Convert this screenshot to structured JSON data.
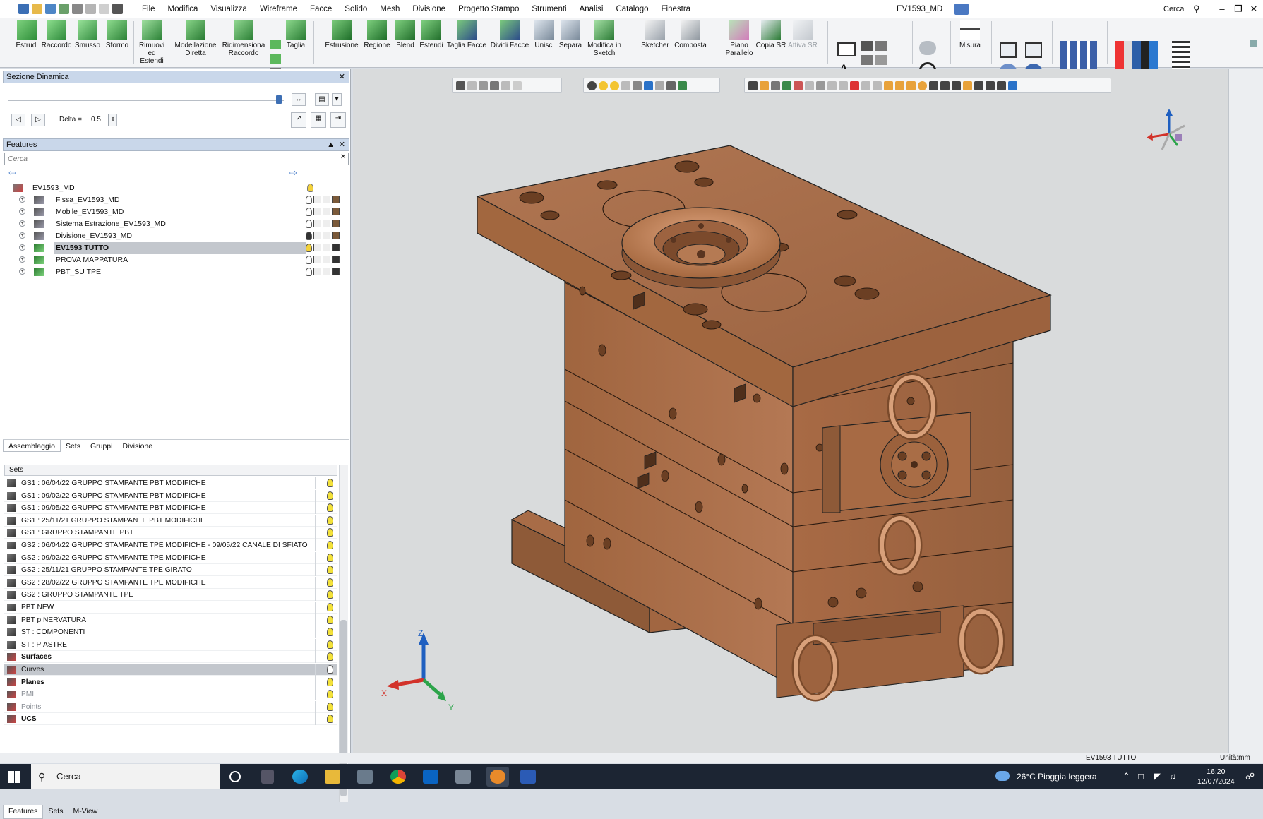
{
  "menu": [
    "File",
    "Modifica",
    "Visualizza",
    "Wireframe",
    "Facce",
    "Solido",
    "Mesh",
    "Divisione",
    "Progetto Stampo",
    "Strumenti",
    "Analisi",
    "Catalogo",
    "Finestra"
  ],
  "doc_title": "EV1593_MD",
  "search": {
    "label": "Cerca"
  },
  "ribbon": {
    "estrudi": "Estrudi",
    "raccordo": "Raccordo",
    "smusso": "Smusso",
    "sformo": "Sformo",
    "rimuovi_1": "Rimuovi ed",
    "rimuovi_2": "Estendi",
    "modellazione_1": "Modellazione",
    "modellazione_2": "Diretta",
    "ridim_1": "Ridimensiona",
    "ridim_2": "Raccordo",
    "taglia": "Taglia",
    "estrusione": "Estrusione",
    "regione": "Regione",
    "blend": "Blend",
    "estendi": "Estendi",
    "taglia_facce": "Taglia Facce",
    "dividi_facce": "Dividi Facce",
    "unisci": "Unisci",
    "separa": "Separa",
    "modifica_sketch_1": "Modifica in",
    "modifica_sketch_2": "Sketch",
    "sketcher": "Sketcher",
    "composta": "Composta",
    "piano_1": "Piano",
    "piano_2": "Parallelo",
    "copia_sr": "Copia SR",
    "attiva_sr": "Attiva SR",
    "misura": "Misura"
  },
  "sezione": {
    "title": "Sezione Dinamica",
    "delta_label": "Delta =",
    "delta_value": "0.5"
  },
  "features": {
    "title": "Features",
    "search_placeholder": "Cerca",
    "root": "EV1593_MD",
    "items": [
      {
        "label": "Fissa_EV1593_MD"
      },
      {
        "label": "Mobile_EV1593_MD"
      },
      {
        "label": "Sistema Estrazione_EV1593_MD"
      },
      {
        "label": "Divisione_EV1593_MD"
      },
      {
        "label": "EV1593 TUTTO"
      },
      {
        "label": "PROVA MAPPATURA"
      },
      {
        "label": "PBT_SU TPE"
      }
    ]
  },
  "tabs_top": [
    "Assemblaggio",
    "Sets",
    "Gruppi",
    "Divisione"
  ],
  "sets": {
    "header": "Sets",
    "rows": [
      "GS1 : 06/04/22 GRUPPO STAMPANTE PBT MODIFICHE",
      "GS1 : 09/02/22 GRUPPO STAMPANTE PBT MODIFICHE",
      "GS1 : 09/05/22 GRUPPO STAMPANTE PBT MODIFICHE",
      "GS1 : 25/11/21 GRUPPO STAMPANTE PBT MODIFICHE",
      "GS1 : GRUPPO STAMPANTE PBT",
      "GS2 : 06/04/22 GRUPPO STAMPANTE TPE MODIFICHE - 09/05/22 CANALE DI SFIATO",
      "GS2 : 09/02/22 GRUPPO STAMPANTE TPE MODIFICHE",
      "GS2 : 25/11/21 GRUPPO STAMPANTE TPE GIRATO",
      "GS2 : 28/02/22 GRUPPO STAMPANTE TPE MODIFICHE",
      "GS2 : GRUPPO STAMPANTE TPE",
      "PBT NEW",
      "PBT p NERVATURA",
      "ST : COMPONENTI",
      "ST : PIASTRE",
      "Surfaces",
      "Curves",
      "Planes",
      "PMI",
      "Points",
      "UCS"
    ]
  },
  "tabs_bottom": [
    "Features",
    "Sets",
    "M-View"
  ],
  "triad": {
    "x": "X",
    "y": "Y",
    "z": "Z"
  },
  "status": {
    "doc": "EV1593 TUTTO",
    "units": "Unità:mm"
  },
  "taskbar": {
    "search": "Cerca",
    "weather": "26°C  Pioggia leggera",
    "time": "16:20",
    "date": "12/07/2024"
  },
  "colors": {
    "copper": "#b8784f",
    "copper_dark": "#8a5634",
    "copper_light": "#cf9068",
    "selection": "#c3c7cd"
  }
}
